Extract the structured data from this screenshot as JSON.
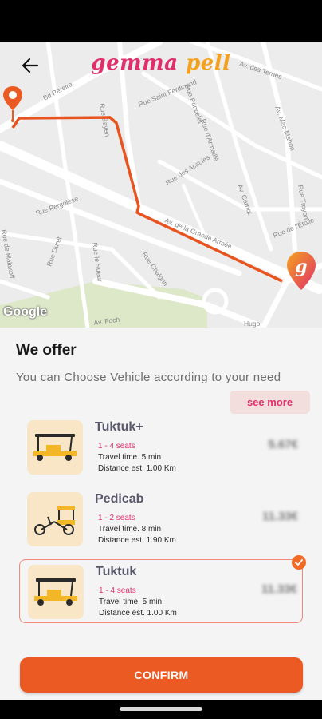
{
  "app": {
    "logo_part1": "gemma",
    "logo_part2": "pell"
  },
  "map": {
    "attribution": "Google",
    "streets": [
      "Bd Pereire",
      "Av. des Ternes",
      "Rue Bayen",
      "Rue Poncelet",
      "Rue Saint Ferdinand",
      "Rue d'Armaillé",
      "Rue des Acacies",
      "Av. Mac-Mahon",
      "Rue Pergolèse",
      "Av. de la Grande Armée",
      "Av. Carnot",
      "Rue Duret",
      "Rue le Sueur",
      "Rue Chalgrin",
      "Rue Troyon",
      "Rue de l'Étoile",
      "Av. Foch",
      "Rue de Malakoff",
      "Hugo"
    ]
  },
  "offer": {
    "title": "We offer",
    "subtitle": "You can Choose Vehicle according to your need",
    "see_more": "see more"
  },
  "vehicles": [
    {
      "name": "Tuktuk+",
      "seats": "1 - 4 seats",
      "time": "Travel time. 5 min",
      "distance": "Distance est. 1.00 Km",
      "price": "5.67€",
      "icon": "tuktuk-icon",
      "selected": false
    },
    {
      "name": "Pedicab",
      "seats": "1 - 2 seats",
      "time": "Travel time. 8 min",
      "distance": "Distance est. 1.90 Km",
      "price": "11.33€",
      "icon": "pedicab-icon",
      "selected": false
    },
    {
      "name": "Tuktuk",
      "seats": "1 - 4 seats",
      "time": "Travel time. 5 min",
      "distance": "Distance est. 1.00 Km",
      "price": "11.33€",
      "icon": "tuktuk-icon",
      "selected": true
    }
  ],
  "confirm_label": "CONFIRM",
  "colors": {
    "accent": "#ec5a24",
    "brand_pink": "#e0306b",
    "brand_orange": "#f4a21e",
    "selected_border": "#ef8a78"
  }
}
